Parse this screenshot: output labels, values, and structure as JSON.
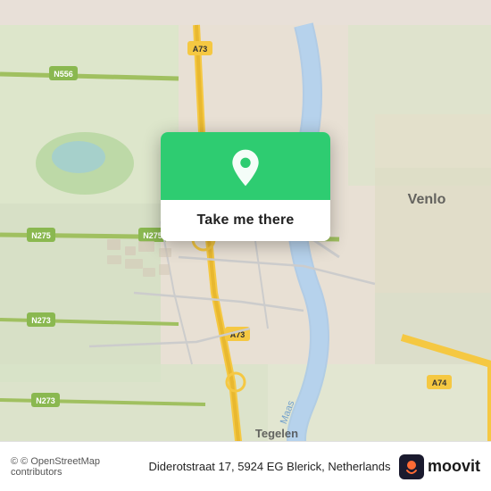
{
  "map": {
    "alt": "Map of Blerick, Venlo, Netherlands"
  },
  "popup": {
    "button_label": "Take me there"
  },
  "bottom_bar": {
    "copyright": "© OpenStreetMap contributors",
    "address": "Diderotstraat 17, 5924 EG Blerick, Netherlands",
    "logo": "moovit"
  }
}
